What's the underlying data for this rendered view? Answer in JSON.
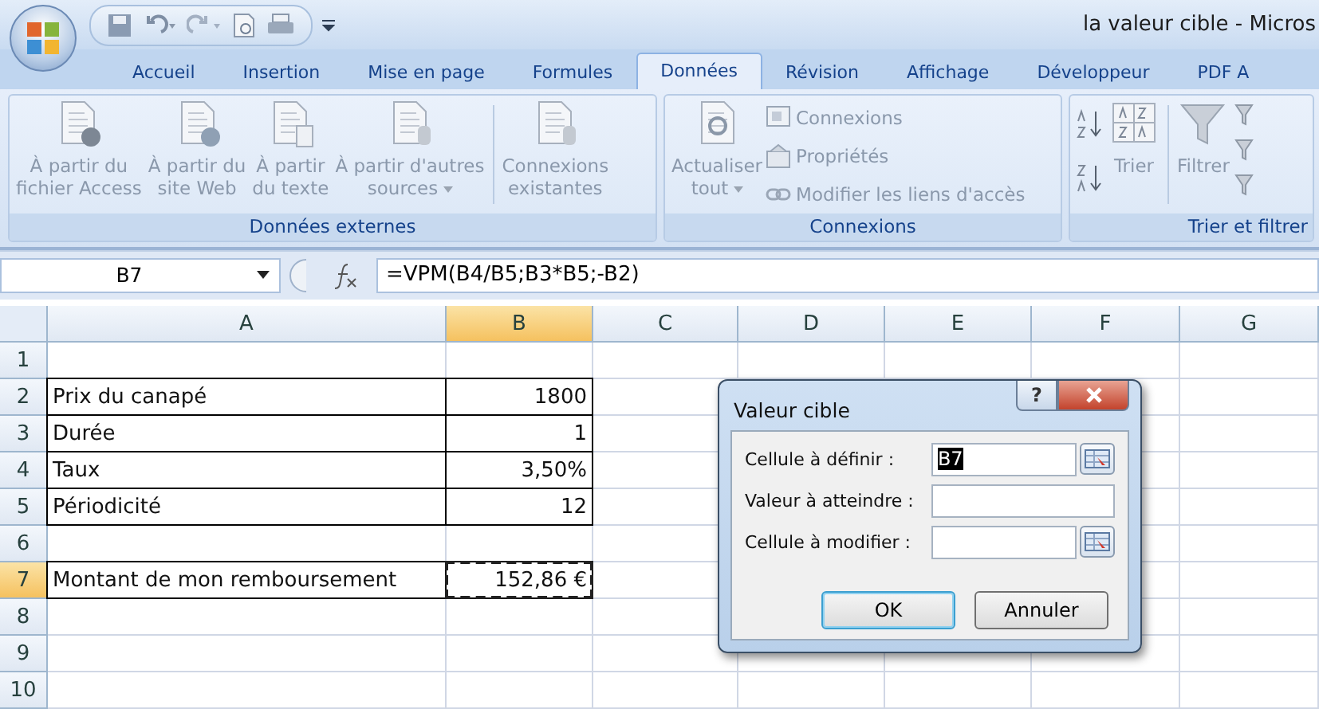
{
  "window": {
    "title": "la valeur cible - Micros"
  },
  "tabs": [
    {
      "label": "Accueil",
      "selected": false
    },
    {
      "label": "Insertion",
      "selected": false
    },
    {
      "label": "Mise en page",
      "selected": false
    },
    {
      "label": "Formules",
      "selected": false
    },
    {
      "label": "Données",
      "selected": true
    },
    {
      "label": "Révision",
      "selected": false
    },
    {
      "label": "Affichage",
      "selected": false
    },
    {
      "label": "Développeur",
      "selected": false
    },
    {
      "label": "PDF A",
      "selected": false
    }
  ],
  "ribbon": {
    "disabled": true,
    "groups": [
      {
        "label": "Données externes",
        "commands": [
          {
            "kind": "large",
            "label": "À partir du\nfichier Access",
            "dropdown": false
          },
          {
            "kind": "large",
            "label": "À partir du\nsite Web",
            "dropdown": false
          },
          {
            "kind": "large",
            "label": "À partir\ndu texte",
            "dropdown": false
          },
          {
            "kind": "large",
            "label": "À partir d'autres\nsources",
            "dropdown": true
          },
          {
            "kind": "large",
            "label": "Connexions\nexistantes",
            "dropdown": false
          }
        ]
      },
      {
        "label": "Connexions",
        "commands": [
          {
            "kind": "large",
            "label": "Actualiser\ntout",
            "dropdown": true
          },
          {
            "kind": "stack",
            "items": [
              {
                "label": "Connexions"
              },
              {
                "label": "Propriétés"
              },
              {
                "label": "Modifier les liens d'accès"
              }
            ]
          }
        ]
      },
      {
        "label": "Trier et filtrer",
        "commands": [
          {
            "kind": "sortpair"
          },
          {
            "kind": "large",
            "label": "Trier",
            "dropdown": false
          },
          {
            "kind": "large",
            "label": "Filtrer",
            "dropdown": false
          },
          {
            "kind": "minis"
          }
        ]
      }
    ]
  },
  "formula_bar": {
    "name_box": "B7",
    "formula": "=VPM(B4/B5;B3*B5;-B2)"
  },
  "columns": [
    {
      "label": "A",
      "selected": false
    },
    {
      "label": "B",
      "selected": true
    },
    {
      "label": "C",
      "selected": false
    },
    {
      "label": "D",
      "selected": false
    },
    {
      "label": "E",
      "selected": false
    },
    {
      "label": "F",
      "selected": false
    },
    {
      "label": "G",
      "selected": false
    }
  ],
  "rows": [
    {
      "number": "1",
      "selected": false,
      "outlined": false,
      "copy_marquee": false,
      "cells": []
    },
    {
      "number": "2",
      "selected": false,
      "outlined": true,
      "copy_marquee": false,
      "cells": [
        "Prix du canapé",
        "1800"
      ]
    },
    {
      "number": "3",
      "selected": false,
      "outlined": true,
      "copy_marquee": false,
      "cells": [
        "Durée",
        "1"
      ]
    },
    {
      "number": "4",
      "selected": false,
      "outlined": true,
      "copy_marquee": false,
      "cells": [
        "Taux",
        "3,50%"
      ]
    },
    {
      "number": "5",
      "selected": false,
      "outlined": true,
      "copy_marquee": false,
      "cells": [
        "Périodicité",
        "12"
      ]
    },
    {
      "number": "6",
      "selected": false,
      "outlined": false,
      "copy_marquee": false,
      "cells": []
    },
    {
      "number": "7",
      "selected": true,
      "outlined": true,
      "copy_marquee": true,
      "cells": [
        "Montant de mon remboursement",
        "152,86 €"
      ]
    },
    {
      "number": "8",
      "selected": false,
      "outlined": false,
      "copy_marquee": false,
      "cells": []
    },
    {
      "number": "9",
      "selected": false,
      "outlined": false,
      "copy_marquee": false,
      "cells": []
    },
    {
      "number": "10",
      "selected": false,
      "outlined": false,
      "copy_marquee": false,
      "cells": []
    }
  ],
  "dialog": {
    "title": "Valeur cible",
    "help": "?",
    "fields": [
      {
        "label": "Cellule à définir :",
        "value": "B7",
        "text_selected": true,
        "ref_button": true
      },
      {
        "label": "Valeur à atteindre :",
        "ref_button": false
      },
      {
        "label": "Cellule à modifier :",
        "ref_button": true
      }
    ],
    "buttons": [
      {
        "label": "OK",
        "default": true
      },
      {
        "label": "Annuler",
        "default": false
      }
    ]
  }
}
